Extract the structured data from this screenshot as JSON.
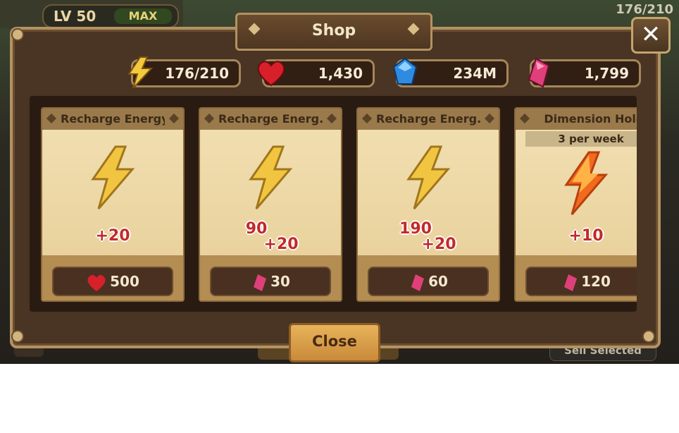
{
  "hud": {
    "level_label": "LV 50",
    "max_badge": "MAX",
    "energy_corner": "176/210",
    "sell_selected_label": "Sell Selected"
  },
  "shop": {
    "title": "Shop",
    "close_label": "Close",
    "close_x": "✕"
  },
  "resources": [
    {
      "name": "energy",
      "value": "176/210",
      "color": "#f0c23a"
    },
    {
      "name": "hearts",
      "value": "1,430",
      "color": "#d8202a"
    },
    {
      "name": "mana",
      "value": "234M",
      "color": "#2f8be0"
    },
    {
      "name": "crystals",
      "value": "1,799",
      "color": "#e0407a"
    }
  ],
  "items": [
    {
      "name": "Recharge Energy",
      "amount_line1": "",
      "amount_line2": "+20",
      "price": "500",
      "currency": "heart",
      "weekly": ""
    },
    {
      "name": "Recharge Energ..",
      "amount_line1": "90",
      "amount_line2": "+20",
      "price": "30",
      "currency": "crystal",
      "weekly": ""
    },
    {
      "name": "Recharge Energ..",
      "amount_line1": "190",
      "amount_line2": "+20",
      "price": "60",
      "currency": "crystal",
      "weekly": ""
    },
    {
      "name": "Dimension Hole",
      "amount_line1": "",
      "amount_line2": "+10",
      "price": "120",
      "currency": "crystal",
      "weekly": "3 per week"
    }
  ]
}
